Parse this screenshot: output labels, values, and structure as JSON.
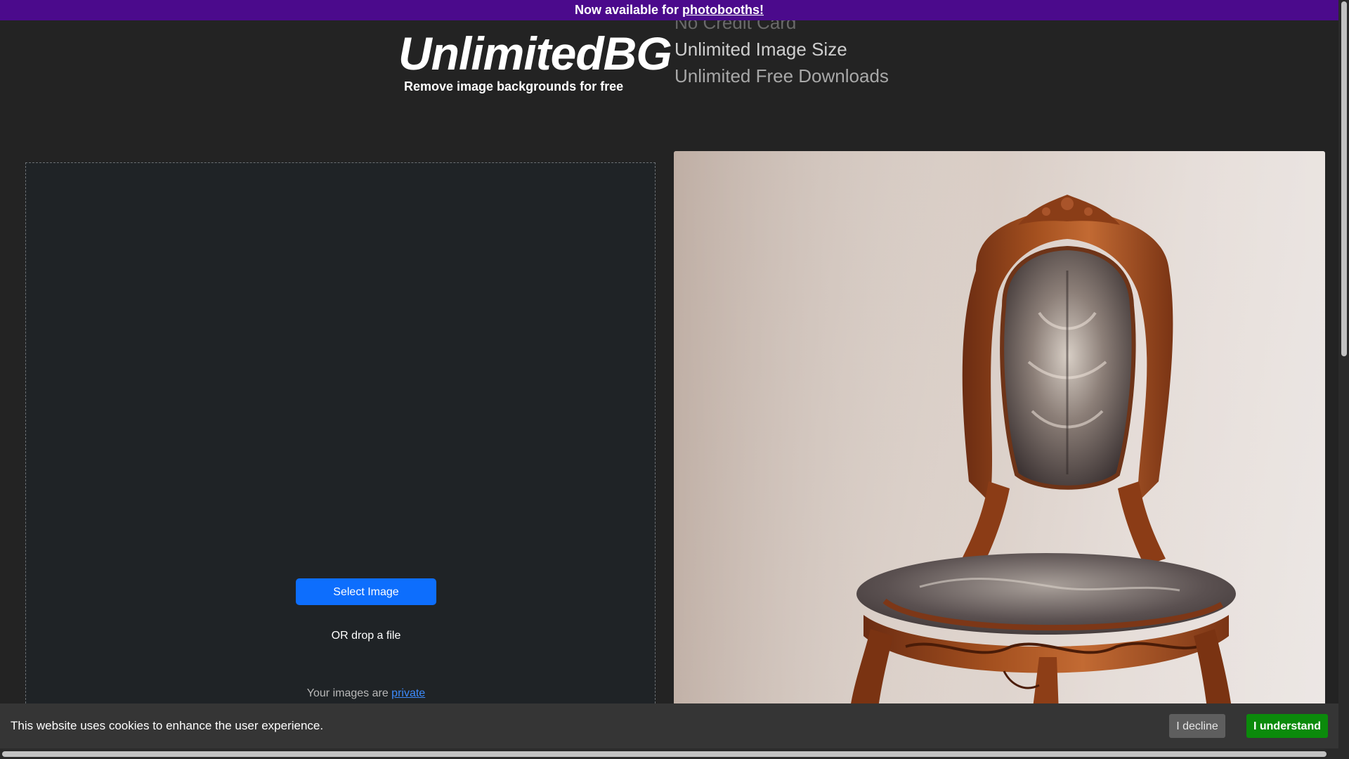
{
  "promo": {
    "text": "Now available for ",
    "link_text": "photobooths!"
  },
  "header": {
    "logo": "UnlimitedBG",
    "tagline": "Remove image backgrounds for free",
    "features": [
      "No Credit Card",
      "Unlimited Image Size",
      "Unlimited Free Downloads"
    ]
  },
  "upload": {
    "select_button": "Select Image",
    "drop_text": "OR drop a file",
    "privacy_prefix": "Your images are ",
    "privacy_link": "private"
  },
  "sample": {
    "subject": "ornate-wooden-chair-photo"
  },
  "cookie": {
    "message": "This website uses cookies to enhance the user experience.",
    "decline_label": "I decline",
    "accept_label": "I understand"
  },
  "colors": {
    "background": "#232323",
    "promo": "#4b0a8c",
    "primary_button": "#0d6efd",
    "accept_button": "#0b8a0b",
    "link": "#3d8bfd"
  }
}
